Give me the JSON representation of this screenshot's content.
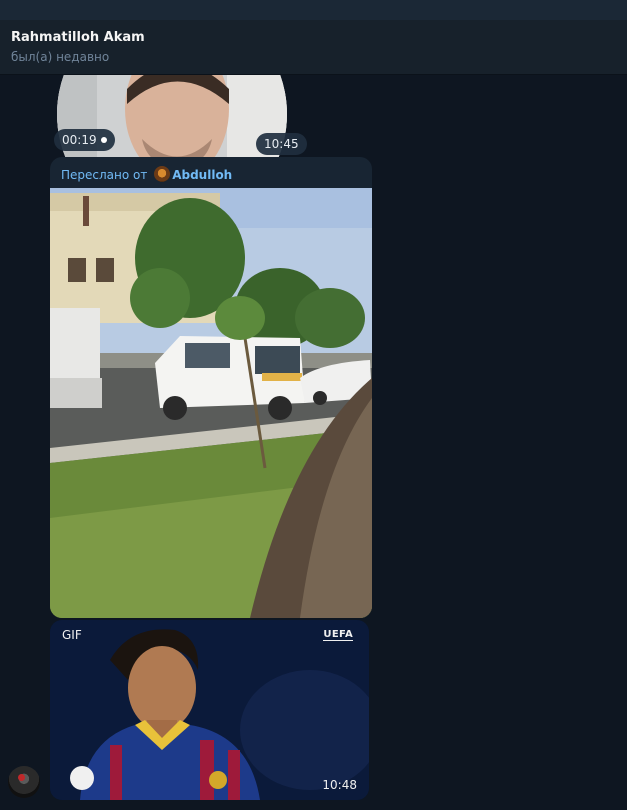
{
  "chat_header": {
    "name": "Rahmatilloh Akam",
    "status": "был(а) недавно"
  },
  "round_video": {
    "duration": "00:19",
    "time": "10:45"
  },
  "forwarded_message": {
    "prefix": "Переслано от",
    "from": "Abdulloh"
  },
  "gif_message": {
    "label": "GIF",
    "overlay_text": "UEFA",
    "time": "10:48"
  },
  "colors": {
    "background": "#0e1621",
    "header": "#17212b",
    "bubble": "#182533",
    "link_blue": "#71baf5",
    "muted": "#708499"
  }
}
